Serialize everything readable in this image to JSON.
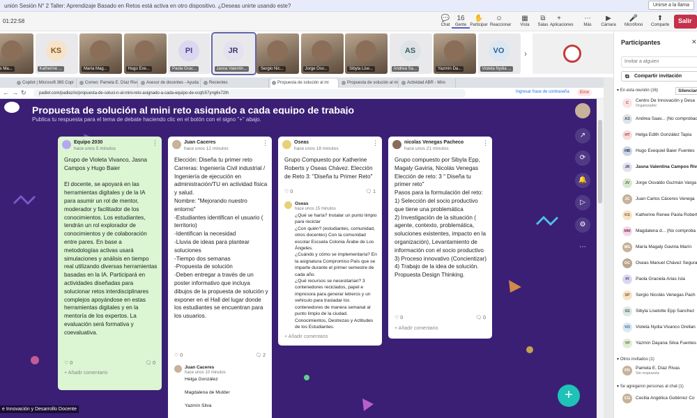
{
  "banner": {
    "text": "unión Sesión N° 2 Taller: Aprendizaje Basado en Retos está activa en otro dispositivo. ¿Deseas unirte usando este?",
    "join": "Unirse a la llama"
  },
  "meeting": {
    "timer": "01:22:58",
    "leave": "Salir",
    "buttons": [
      {
        "label": "Chat",
        "icon": "💬"
      },
      {
        "label": "Gente",
        "icon": "16"
      },
      {
        "label": "Participar",
        "icon": "✋"
      },
      {
        "label": "Reaccionar",
        "icon": "☺"
      },
      {
        "label": "Vista",
        "icon": "▦"
      },
      {
        "label": "Salas",
        "icon": "⧉"
      },
      {
        "label": "Aplicaciones",
        "icon": "+"
      },
      {
        "label": "Más",
        "icon": "⋯"
      },
      {
        "label": "Cámara",
        "icon": "▶"
      },
      {
        "label": "Micrófono",
        "icon": "🎤"
      },
      {
        "label": "Comparte",
        "icon": "⬆"
      }
    ]
  },
  "tiles": [
    {
      "name": "eas Ma...",
      "initials": "",
      "photo": true
    },
    {
      "name": "Katherine ...",
      "initials": "KS",
      "photo": false,
      "bg": "#f6e3c9",
      "fg": "#8a5a1a"
    },
    {
      "name": "María Mag...",
      "initials": "",
      "photo": true
    },
    {
      "name": "Hugo Exe...",
      "initials": "",
      "photo": true
    },
    {
      "name": "Paola Grac...",
      "initials": "PI",
      "photo": false,
      "bg": "#dcd7f0",
      "fg": "#4a3f8a"
    },
    {
      "name": "Jasna Valentin...",
      "initials": "JR",
      "photo": false,
      "bg": "#e4e2ef",
      "fg": "#3b3b6b"
    },
    {
      "name": "Sergio Nic...",
      "initials": "",
      "photo": true
    },
    {
      "name": "Jorge Osv...",
      "initials": "",
      "photo": true
    },
    {
      "name": "Sibyla Lise...",
      "initials": "",
      "photo": true
    },
    {
      "name": "Andrea Sa...",
      "initials": "AS",
      "photo": false,
      "bg": "#dde3e6",
      "fg": "#3f5b66"
    },
    {
      "name": "Yazmín Da...",
      "initials": "",
      "photo": true
    },
    {
      "name": "Violeta Nydia ...",
      "initials": "VO",
      "photo": false,
      "bg": "#dbe7f3",
      "fg": "#2f5f8f"
    }
  ],
  "browser": {
    "tabs": [
      "Copilot | Microsoft 365 Copi",
      "Correo: Pamela E. Díaz Rivas",
      "Asesor de docentes - Ayuda",
      "Recientes",
      "Propuesta de solución al mi",
      "Propuesta de solución al mi",
      "Actividad ABR - Miro"
    ],
    "url": "padlet.com/padlaz/ix/propuesta-de-soluci-n-al-mini-reto-asignado-a-cada-equipo-de-vcqfc57yng6x72th",
    "password_prompt": "Ingresar frase de contraseña",
    "error": "Error"
  },
  "padlet": {
    "title": "Propuesta de solución al mini reto asignado a cada equipo de trabajo",
    "subtitle": "Publica tu respuesta para el tema de debate haciendo clic en el botón con el signo \"+\" abajo.",
    "add_comment": "Añadir comentario",
    "caption": "e Innovación y Desarrollo Docente",
    "fab": "+",
    "posts": [
      {
        "author": "Equipo 2030",
        "time": "hace unos 5 minutos",
        "likes": "0",
        "comments": "0",
        "text": "Grupo de Violeta Vivanco, Jasna Campos y Hugo Baier\n\nEl docente, se apoyará en las herramientas digitales y de la IA para asumir un rol de mentor, moderador y facilitador de los conocimientos. Los estudiantes, tendrán un rol explorador de conocimientos y de colaboración entre pares. En base a metodologías activas usará simulaciones y análisis en tiempo real utilizando diversas herramientas basadas en la IA. Participará en actividades diseñadas para solucionar retos interdisciplinares complejos apoyándose en estas herramientas digitales y en la mentoría de los expertos. La evaluación será formativa y coevaluativa."
      },
      {
        "author": "Juan Caceres",
        "time": "hace unos 12 minutos",
        "likes": "0",
        "comments": "2",
        "text": "Elección: Diseña tu primer reto\nCarreras: Ingeniería Civil industrial / Ingeniería de ejecución en administración/TU en actividad física y salud.\nNombre: \"Mejorando nuestro entorno\"\n-Estudiantes identifican el usuario ( territorio)\n-Identifican  la necesidad\n-Lluvia de ideas para plantear soluciones\n-Tiempo dos semanas\n-Propuesta de solución\n-Deben entregar a través de un poster informativo que incluya dibujos de la propuesta de solución y exponer en el Hall del lugar donde los estudiantes se encuentran para  los usuarios.",
        "comment": {
          "author": "Juan Caceres",
          "time": "hace unos 10 minutos",
          "text": "Helga González\n\nMagdalena de Mulder\n\nYazmín Silva"
        }
      },
      {
        "author": "Oseas",
        "time": "hace unos 18 minutos",
        "likes": "0",
        "comments": "1",
        "text": "Grupo Compuesto por Katherine Roberts y Oseas Chávez.  Elección de Reto 3: \"Diseña tu Primer Reto\"",
        "comment": {
          "author": "Oseas",
          "time": "hace unos 15 minutos",
          "text": "¿Qué se haría? Instalar un punto limpio para reciclar\n¿Con quién? (estudiantes, comunidad, otros docentes) Con la comunidad escolar Escuela Colonia Árabe de Los Ángeles.\n¿Cuándo y cómo se implementaría? En la asignatura Compromiso País que se imparte durante el primer semestre de cada año.\n¿Qué recursos se necesitarían? 3 contenedores reciclados, papel e impresora para generar letreros y un vehículo para trasladar los contenedores de manera semanal al punto limpio de la ciudad.  Conocimientos, Destrezas y Actitudes de los Estudiantes."
        }
      },
      {
        "author": "nicolas Venegas Pacheco",
        "time": "hace unos 21 minutos",
        "likes": "0",
        "comments": "0",
        "text": "Grupo compuesto por Sibyla Epp, Magaly Gaviria, Nicolás Venegas\nElección de reto: 3 \" Diseña tu primer reto\"\nPasos para la formulación del reto:\n1) Selección del socio productivo que tiene una problemática\n2) Investigación de la situación ( agente, contexto, problemática, soluciones existentes, impacto en la organización), Levantamiento de información con el socio productivo\n3) Proceso innovativo (Concientizar)\n4) Trabajo de la idea de solución. Propuesta Design Thinking."
      }
    ]
  },
  "panel": {
    "title": "Participantes",
    "search_placeholder": "Invitar a alguien",
    "share": "Compartir invitación",
    "in_meeting": "En esta reunión (16)",
    "mute_all": "Silenciar a",
    "others": "Otros invitados (1)",
    "chat_added": "Se agregaron personas al chat (1)",
    "people": [
      {
        "name": "Centro De Innovación y Desa",
        "sub": "Organizador",
        "initials": "C",
        "bg": "#fbe3e3",
        "fg": "#c43b3b"
      },
      {
        "name": "Andrea Saav... (No comprobad",
        "initials": "AS",
        "bg": "#dde3e6",
        "fg": "#3f5b66"
      },
      {
        "name": "Helga Edith González Tapia",
        "initials": "HT",
        "bg": "#f7dcdc",
        "fg": "#a33b3b"
      },
      {
        "name": "Hugo Exequiel Baier Fuentes",
        "initials": "HB",
        "bg": "#c9d6e8",
        "fg": "#234"
      },
      {
        "name": "Jasna Valentina Campos Riv",
        "initials": "JR",
        "bg": "#e4e2ef",
        "fg": "#3b3b6b",
        "bold": true
      },
      {
        "name": "Jorge Osvaldo Guzmán Varga",
        "initials": "JV",
        "bg": "#d9e7d2",
        "fg": "#3c6a2a"
      },
      {
        "name": "Juan Carlos Cáceres Venega",
        "initials": "JC",
        "bg": "#c7b29a",
        "fg": "#fff"
      },
      {
        "name": "Katherine Renee Paola Robert",
        "initials": "KS",
        "bg": "#f6e3c9",
        "fg": "#8a5a1a"
      },
      {
        "name": "Magdalena d... (No comproba",
        "initials": "MM",
        "bg": "#f3d9e6",
        "fg": "#8a2f5c"
      },
      {
        "name": "María Magaly Gaviria Marín",
        "initials": "MG",
        "bg": "#c7b29a",
        "fg": "#fff"
      },
      {
        "name": "Oseas Manuel Chávez Segura",
        "initials": "OC",
        "bg": "#bba590",
        "fg": "#fff"
      },
      {
        "name": "Paola Graciela Arias Isla",
        "initials": "PI",
        "bg": "#dcd7f0",
        "fg": "#4a3f8a"
      },
      {
        "name": "Sergio Nicolás Venegas Pach",
        "initials": "SP",
        "bg": "#f6e3c9",
        "fg": "#8a5a1a"
      },
      {
        "name": "Sibyla Liselotte Epp Sanchez",
        "initials": "SS",
        "bg": "#dde7e4",
        "fg": "#2f6b5a"
      },
      {
        "name": "Violeta Nydia Vivanco Orellan",
        "initials": "VO",
        "bg": "#dbe7f3",
        "fg": "#2f5f8f"
      },
      {
        "name": "Yazmín Dayana Silva Fuentes",
        "initials": "YP",
        "bg": "#e2ecd8",
        "fg": "#4a6b2f"
      }
    ],
    "invited": [
      {
        "name": "Pamela E. Díaz Rivas",
        "sub": "Sin respuesta",
        "initials": "PD",
        "bg": "#c7b29a",
        "fg": "#fff"
      }
    ],
    "chat": [
      {
        "name": "Cecilia Angélica Gutiérrez Co",
        "initials": "CG",
        "bg": "#c7b29a",
        "fg": "#fff"
      }
    ]
  }
}
